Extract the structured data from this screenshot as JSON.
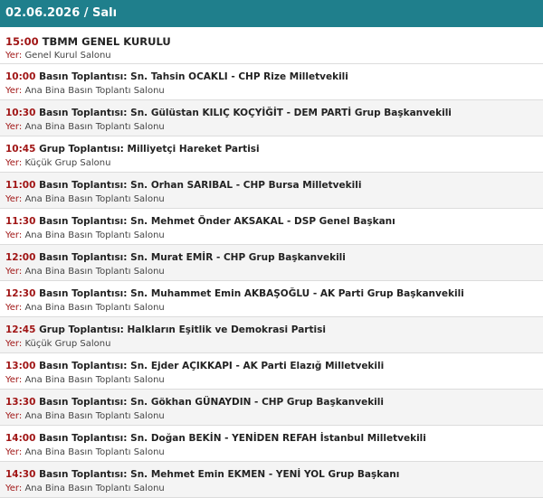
{
  "header": {
    "date_day": "02.06.2026 / Salı"
  },
  "location_prefix": "Yer:",
  "items": [
    {
      "time": "15:00",
      "title": "TBMM GENEL KURULU",
      "location": "Genel Kurul Salonu"
    },
    {
      "time": "10:00",
      "title": "Basın Toplantısı: Sn. Tahsin OCAKLI - CHP Rize Milletvekili",
      "location": "Ana Bina Basın Toplantı Salonu"
    },
    {
      "time": "10:30",
      "title": "Basın Toplantısı: Sn. Gülüstan KILIÇ KOÇYİĞİT - DEM PARTİ Grup Başkanvekili",
      "location": "Ana Bina Basın Toplantı Salonu"
    },
    {
      "time": "10:45",
      "title": "Grup Toplantısı: Milliyetçi Hareket Partisi",
      "location": "Küçük Grup Salonu"
    },
    {
      "time": "11:00",
      "title": "Basın Toplantısı: Sn. Orhan SARIBAL - CHP Bursa Milletvekili",
      "location": "Ana Bina Basın Toplantı Salonu"
    },
    {
      "time": "11:30",
      "title": "Basın Toplantısı: Sn. Mehmet Önder AKSAKAL - DSP Genel Başkanı",
      "location": "Ana Bina Basın Toplantı Salonu"
    },
    {
      "time": "12:00",
      "title": "Basın Toplantısı: Sn. Murat EMİR - CHP Grup Başkanvekili",
      "location": "Ana Bina Basın Toplantı Salonu"
    },
    {
      "time": "12:30",
      "title": "Basın Toplantısı: Sn. Muhammet Emin AKBAŞOĞLU - AK Parti Grup Başkanvekili",
      "location": "Ana Bina Basın Toplantı Salonu"
    },
    {
      "time": "12:45",
      "title": "Grup Toplantısı: Halkların Eşitlik ve Demokrasi Partisi",
      "location": "Küçük Grup Salonu"
    },
    {
      "time": "13:00",
      "title": "Basın Toplantısı: Sn. Ejder AÇIKKAPI - AK Parti Elazığ Milletvekili",
      "location": "Ana Bina Basın Toplantı Salonu"
    },
    {
      "time": "13:30",
      "title": "Basın Toplantısı: Sn. Gökhan GÜNAYDIN - CHP Grup Başkanvekili",
      "location": "Ana Bina Basın Toplantı Salonu"
    },
    {
      "time": "14:00",
      "title": "Basın Toplantısı: Sn. Doğan BEKİN - YENİDEN REFAH İstanbul Milletvekili",
      "location": "Ana Bina Basın Toplantı Salonu"
    },
    {
      "time": "14:30",
      "title": "Basın Toplantısı: Sn. Mehmet Emin EKMEN - YENİ YOL Grup Başkanı",
      "location": "Ana Bina Basın Toplantı Salonu"
    }
  ]
}
